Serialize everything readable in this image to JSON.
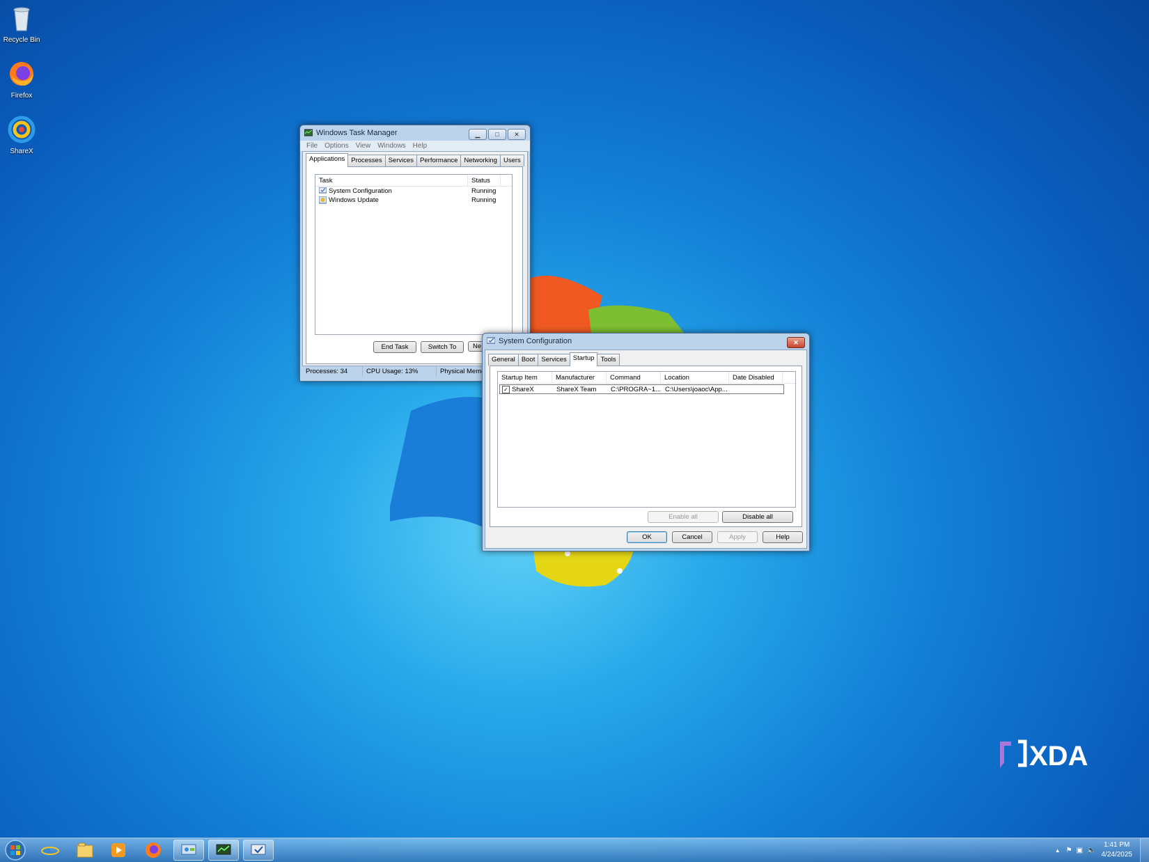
{
  "desktop": {
    "icons": [
      {
        "label": "Recycle Bin",
        "icon": "recycle-bin-icon"
      },
      {
        "label": "Firefox",
        "icon": "firefox-icon"
      },
      {
        "label": "ShareX",
        "icon": "sharex-icon"
      }
    ],
    "watermark": "XDA"
  },
  "task_manager": {
    "title": "Windows Task Manager",
    "menu": [
      "File",
      "Options",
      "View",
      "Windows",
      "Help"
    ],
    "tabs": [
      "Applications",
      "Processes",
      "Services",
      "Performance",
      "Networking",
      "Users"
    ],
    "active_tab": "Applications",
    "columns": [
      "Task",
      "Status"
    ],
    "rows": [
      {
        "task": "System Configuration",
        "status": "Running"
      },
      {
        "task": "Windows Update",
        "status": "Running"
      }
    ],
    "buttons": {
      "end_task": "End Task",
      "switch_to": "Switch To",
      "new_task": "Ne"
    },
    "statusbar": {
      "processes": "Processes: 34",
      "cpu": "CPU Usage: 13%",
      "memory": "Physical Memo"
    }
  },
  "msconfig": {
    "title": "System Configuration",
    "tabs": [
      "General",
      "Boot",
      "Services",
      "Startup",
      "Tools"
    ],
    "active_tab": "Startup",
    "columns": [
      "Startup Item",
      "Manufacturer",
      "Command",
      "Location",
      "Date Disabled"
    ],
    "rows": [
      {
        "checked": true,
        "item": "ShareX",
        "manufacturer": "ShareX Team",
        "command": "C:\\PROGRA~1...",
        "location": "C:\\Users\\joaoc\\App...",
        "date_disabled": ""
      }
    ],
    "enable_all": "Enable all",
    "disable_all": "Disable all",
    "buttons": {
      "ok": "OK",
      "cancel": "Cancel",
      "apply": "Apply",
      "help": "Help"
    }
  },
  "taskbar": {
    "clock_time": "1:41 PM",
    "clock_date": "4/24/2025"
  },
  "colors": {
    "accent": "#1a7fd4",
    "titlebar": "#bcd3ec"
  }
}
